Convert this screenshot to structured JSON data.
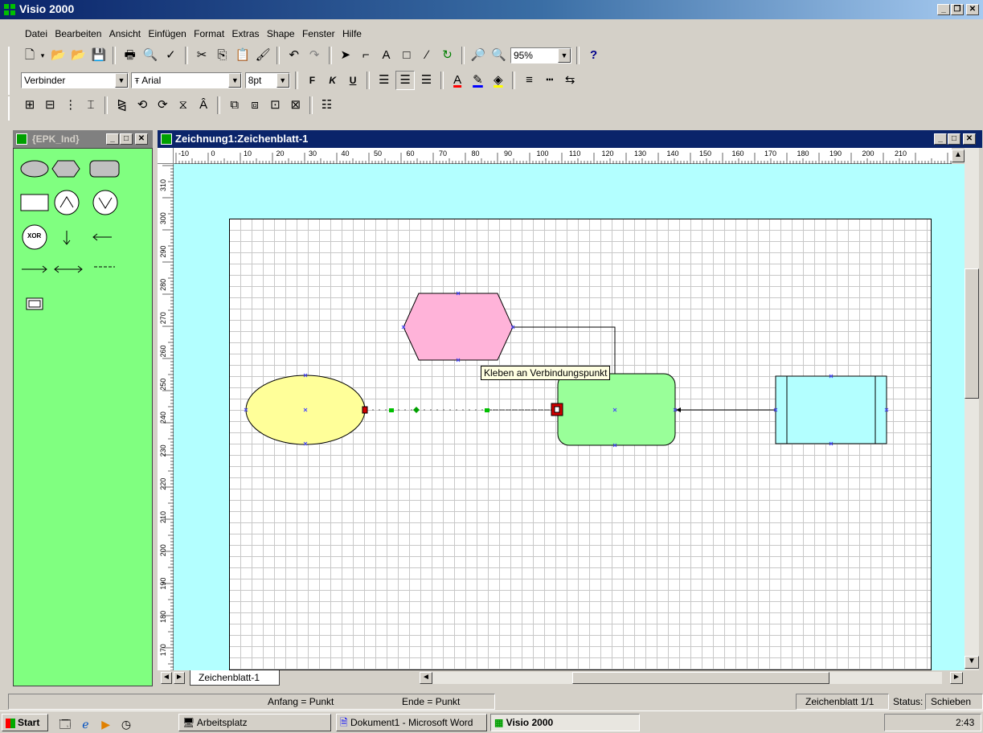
{
  "app": {
    "title": "Visio 2000"
  },
  "menu": [
    "Datei",
    "Bearbeiten",
    "Ansicht",
    "Einfügen",
    "Format",
    "Extras",
    "Shape",
    "Fenster",
    "Hilfe"
  ],
  "format_toolbar": {
    "style": "Verbinder",
    "font": "Arial",
    "size": "8pt",
    "bold": "F",
    "italic": "K",
    "underline": "U"
  },
  "standard_toolbar": {
    "zoom": "95%",
    "help": "?"
  },
  "stencil": {
    "title": "{EPK_Ind}",
    "xor_label": "XOR"
  },
  "document": {
    "title": "Zeichnung1:Zeichenblatt-1",
    "page_tab": "Zeichenblatt-1"
  },
  "ruler_top": [
    "-10",
    "0",
    "10",
    "20",
    "30",
    "40",
    "50",
    "60",
    "70",
    "80",
    "90",
    "100",
    "110",
    "120",
    "130",
    "140",
    "150",
    "160",
    "170",
    "180",
    "190",
    "200",
    "210"
  ],
  "ruler_left": [
    "310",
    "300",
    "290",
    "280",
    "270",
    "260",
    "250",
    "240",
    "230",
    "220",
    "210",
    "200",
    "190",
    "180",
    "170"
  ],
  "drawing": {
    "tooltip": "Kleben an Verbindungspunkt",
    "colors": {
      "ellipse": "#ffff99",
      "hexagon": "#ffb3d9",
      "rounded_rect": "#99ff99",
      "rect": "#b3ffff"
    }
  },
  "status": {
    "start": "Anfang = Punkt",
    "end": "Ende = Punkt",
    "page": "Zeichenblatt 1/1",
    "status_label": "Status:",
    "status_value": "Schieben"
  },
  "taskbar": {
    "start": "Start",
    "tasks": [
      "Arbeitsplatz",
      "Dokument1 - Microsoft Word",
      "Visio 2000"
    ],
    "clock": "2:43"
  }
}
